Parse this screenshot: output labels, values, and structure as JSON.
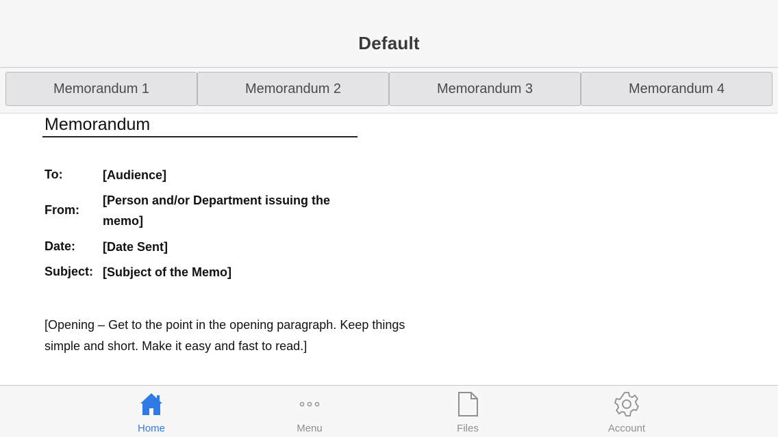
{
  "nav": {
    "title": "Default"
  },
  "segments": [
    {
      "label": "Memorandum 1"
    },
    {
      "label": "Memorandum 2"
    },
    {
      "label": "Memorandum 3"
    },
    {
      "label": "Memorandum 4"
    }
  ],
  "document": {
    "title": "Memorandum",
    "fields": [
      {
        "label": "To:",
        "value": "[Audience]"
      },
      {
        "label": "From:",
        "value": "[Person and/or Department issuing the memo]"
      },
      {
        "label": "Date:",
        "value": "[Date Sent]"
      },
      {
        "label": "Subject:",
        "value": "[Subject of the Memo]"
      }
    ],
    "opening": "[Opening – Get to the point in the opening paragraph. Keep things simple and short. Make it easy and fast to read.]"
  },
  "tabs": [
    {
      "label": "Home",
      "icon": "home-icon",
      "active": true
    },
    {
      "label": "Menu",
      "icon": "more-icon",
      "active": false
    },
    {
      "label": "Files",
      "icon": "file-icon",
      "active": false
    },
    {
      "label": "Account",
      "icon": "gear-icon",
      "active": false
    }
  ],
  "colors": {
    "accent": "#2f7ae5",
    "inactive": "#8e8e93",
    "bar_background": "#f7f7f7",
    "segment_background": "#e4e4e6"
  }
}
